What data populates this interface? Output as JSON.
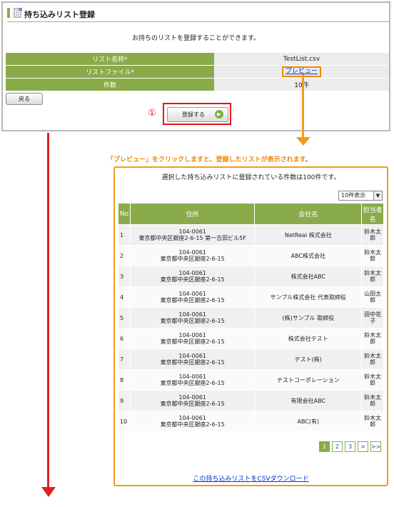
{
  "panel": {
    "title": "持ち込みリスト登録",
    "intro": "お持ちのリストを登録することができます。",
    "fields": [
      {
        "label": "リスト名称*",
        "value": "TestList.csv"
      },
      {
        "label": "リストファイル*",
        "value": "プレビュー"
      },
      {
        "label": "件数",
        "value": "10件"
      }
    ],
    "back_label": "戻る",
    "register_label": "登録する",
    "step_marker": "①"
  },
  "callout": "「プレビュー」をクリックしますと、登録したリストが表示されます。",
  "preview": {
    "summary": "選択した持ち込みリストに登録されている件数は100件です。",
    "page_size": "10件表示",
    "headers": [
      "No",
      "住所",
      "会社名",
      "担当者名"
    ],
    "rows": [
      {
        "no": "1",
        "zip": "104-0061",
        "address": "東京都中央区銀座2-6-15 第一吉田ビル5F",
        "company": "NetReal 株式会社",
        "rep": "鈴木太郎"
      },
      {
        "no": "2",
        "zip": "104-0061",
        "address": "東京都中央区銀座2-6-15",
        "company": "ABC株式会社",
        "rep": "鈴木太郎"
      },
      {
        "no": "3",
        "zip": "104-0061",
        "address": "東京都中央区銀座2-6-15",
        "company": "株式会社ABC",
        "rep": "鈴木太郎"
      },
      {
        "no": "4",
        "zip": "104-0061",
        "address": "東京都中央区銀座2-6-15",
        "company": "サンプル株式会社 代表取締役",
        "rep": "山田太郎"
      },
      {
        "no": "5",
        "zip": "104-0061",
        "address": "東京都中央区銀座2-6-15",
        "company": "(株)サンプル 取締役",
        "rep": "田中花子"
      },
      {
        "no": "6",
        "zip": "104-0061",
        "address": "東京都中央区銀座2-6-15",
        "company": "株式会社テスト",
        "rep": "鈴木太郎"
      },
      {
        "no": "7",
        "zip": "104-0061",
        "address": "東京都中央区銀座2-6-15",
        "company": "テスト(株)",
        "rep": "鈴木太郎"
      },
      {
        "no": "8",
        "zip": "104-0061",
        "address": "東京都中央区銀座2-6-15",
        "company": "テストコーポレーション",
        "rep": "鈴木太郎"
      },
      {
        "no": "9",
        "zip": "104-0061",
        "address": "東京都中央区銀座2-6-15",
        "company": "有限会社ABC",
        "rep": "鈴木太郎"
      },
      {
        "no": "10",
        "zip": "104-0061",
        "address": "東京都中央区銀座2-6-15",
        "company": "ABC(有)",
        "rep": "鈴木太郎"
      }
    ],
    "pages": [
      "1",
      "2",
      "3",
      ">",
      ">>"
    ],
    "download_label": "この持ち込みリストをCSVダウンロード"
  }
}
